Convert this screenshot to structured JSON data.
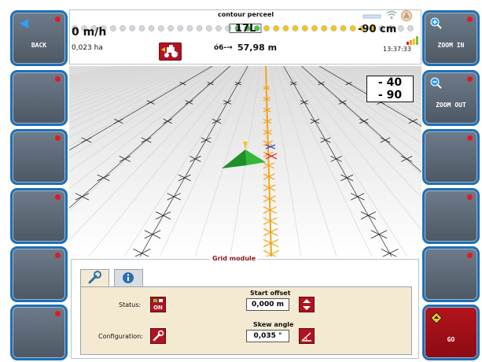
{
  "left_buttons": [
    {
      "label": "BACK",
      "icon": "back-arrow-icon"
    },
    {
      "label": ""
    },
    {
      "label": ""
    },
    {
      "label": ""
    },
    {
      "label": ""
    },
    {
      "label": ""
    }
  ],
  "right_buttons": [
    {
      "label": "ZOOM IN",
      "icon": "zoom-in-icon"
    },
    {
      "label": "ZOOM OUT",
      "icon": "zoom-out-icon"
    },
    {
      "label": ""
    },
    {
      "label": ""
    },
    {
      "label": ""
    },
    {
      "label": "GO",
      "icon": "go-diamond-icon"
    }
  ],
  "status": {
    "title": "contour perceel",
    "speed": "0 m/h",
    "area": "0,023 ha",
    "lane": "17L",
    "distance_icon": "ó6-→",
    "distance": "57,98 m",
    "offset": "-90 cm",
    "clock": "13:37:33",
    "icons": [
      "tractor-icon",
      "wifi-icon",
      "gps-satellite-icon",
      "signal-bars-icon"
    ]
  },
  "xte_display": {
    "line1": "- 40",
    "line2": "- 90"
  },
  "grid_module": {
    "title": "Grid module",
    "tabs": [
      {
        "icon": "wrench-icon"
      },
      {
        "icon": "info-icon"
      }
    ],
    "status_label": "Status:",
    "status_value": "ON",
    "configuration_label": "Configuration:",
    "start_offset_label": "Start offset",
    "start_offset_value": "0,000 m",
    "skew_angle_label": "Skew angle",
    "skew_angle_value": "0,035 °"
  },
  "colors": {
    "button_border": "#1e6fb6",
    "button_fill": "#5c6875",
    "led": "#e0192a",
    "accent_red": "#b01322",
    "guidance_line": "#f2a51a",
    "vehicle": "#2fa82f",
    "panel_bg": "#f4ead2"
  }
}
